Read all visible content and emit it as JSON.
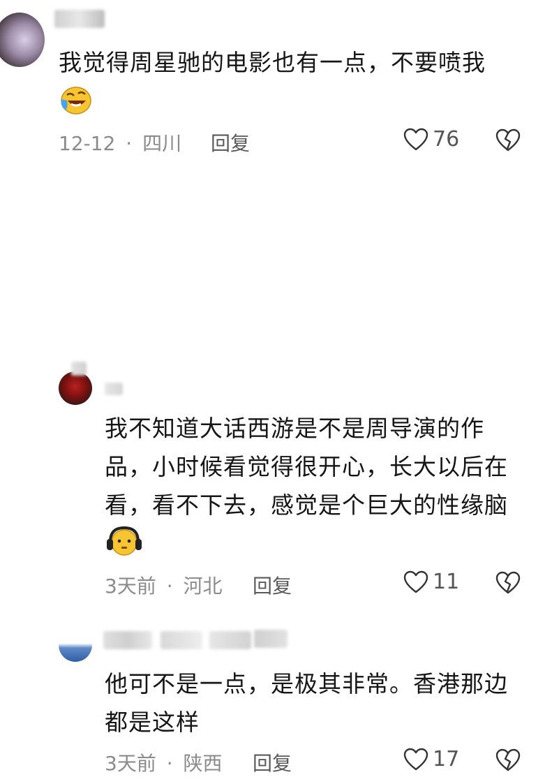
{
  "comments": [
    {
      "text_lines": [
        "我觉得周星驰的电影也有一点，不要喷我"
      ],
      "emoji": "laughing-crying-emoji",
      "date": "12-12",
      "location": "四川",
      "reply_label": "回复",
      "likes": "76"
    },
    {
      "text_lines": [
        "我不知道大话西游是不是周导演的作",
        "品，小时候看觉得很开心，长大以后在",
        "看，看不下去，感觉是个巨大的性缘脑"
      ],
      "emoji": "headphones-face-emoji",
      "date": "3天前",
      "location": "河北",
      "reply_label": "回复",
      "likes": "11"
    },
    {
      "text_lines": [
        "他可不是一点，是极其非常。香港那边",
        "都是这样"
      ],
      "date": "3天前",
      "location": "陕西",
      "reply_label": "回复",
      "likes": "17"
    }
  ],
  "separator": "·",
  "colors": {
    "text": "#161616",
    "meta": "#8b8b8b",
    "icon": "#333333"
  }
}
